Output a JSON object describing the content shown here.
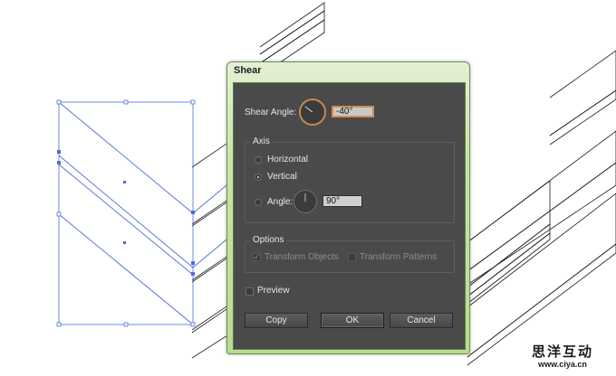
{
  "dialog": {
    "title": "Shear",
    "shear_angle": {
      "label": "Shear Angle:",
      "value": "-40°"
    },
    "axis": {
      "label": "Axis",
      "options": [
        {
          "label": "Horizontal",
          "selected": false
        },
        {
          "label": "Vertical",
          "selected": true
        },
        {
          "label": "Angle:",
          "selected": false
        }
      ],
      "angle_value": "90°"
    },
    "options": {
      "label": "Options",
      "transform_objects": {
        "label": "Transform Objects",
        "checked": true,
        "enabled": false
      },
      "transform_patterns": {
        "label": "Transform Patterns",
        "checked": false,
        "enabled": false
      }
    },
    "preview": {
      "label": "Preview",
      "checked": false
    },
    "buttons": {
      "copy": "Copy",
      "ok": "OK",
      "cancel": "Cancel"
    }
  },
  "watermark": {
    "cn": "思洋互动",
    "url": "www.ciya.cn"
  },
  "colors": {
    "selection": "#4a6fd6",
    "dialog_bg": "#4a4a4a",
    "dialog_frame": "#c7e4a4",
    "focus": "#d28b4b"
  }
}
